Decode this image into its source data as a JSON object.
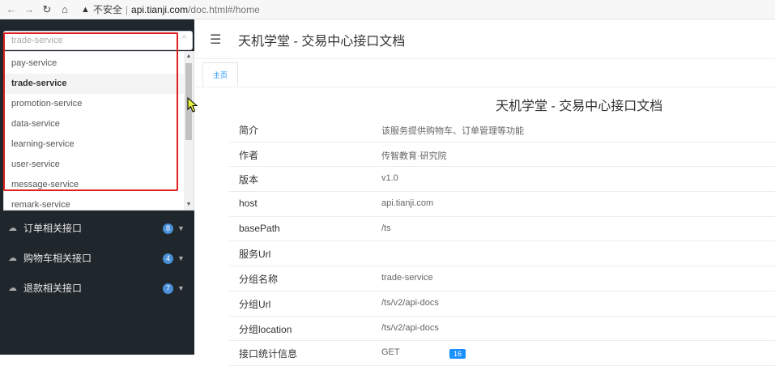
{
  "browser": {
    "insecure_label": "不安全",
    "url_host": "api.tianji.com",
    "url_path": "/doc.html#/home"
  },
  "sidebar": {
    "search": {
      "value": "",
      "placeholder": "trade-service"
    },
    "dropdown_options": [
      {
        "label": "pay-service"
      },
      {
        "label": "trade-service"
      },
      {
        "label": "promotion-service"
      },
      {
        "label": "data-service"
      },
      {
        "label": "learning-service"
      },
      {
        "label": "user-service"
      },
      {
        "label": "message-service"
      },
      {
        "label": "remark-service"
      }
    ],
    "selected_option": "trade-service",
    "menu": [
      {
        "label": "订单相关接口",
        "count": "8"
      },
      {
        "label": "购物车相关接口",
        "count": "4"
      },
      {
        "label": "退款相关接口",
        "count": "7"
      }
    ]
  },
  "header": {
    "title": "天机学堂 - 交易中心接口文档"
  },
  "tabs": [
    {
      "label": "主页"
    }
  ],
  "doc": {
    "title": "天机学堂 - 交易中心接口文档",
    "rows": [
      {
        "key": "简介",
        "value": "该服务提供购物车、订单管理等功能"
      },
      {
        "key": "作者",
        "value": "传智教育·研究院"
      },
      {
        "key": "版本",
        "value": "v1.0"
      },
      {
        "key": "host",
        "value": "api.tianji.com"
      },
      {
        "key": "basePath",
        "value": "/ts"
      },
      {
        "key": "服务Url",
        "value": ""
      },
      {
        "key": "分组名称",
        "value": "trade-service"
      },
      {
        "key": "分组Url",
        "value": "/ts/v2/api-docs"
      },
      {
        "key": "分组location",
        "value": "/ts/v2/api-docs"
      },
      {
        "key": "接口统计信息",
        "value": "GET",
        "count": "16"
      }
    ]
  },
  "colors": {
    "sidebar_bg": "#1f262c",
    "accent": "#1890ff",
    "highlight_border": "#e02020",
    "badge": "#4a90d9"
  }
}
